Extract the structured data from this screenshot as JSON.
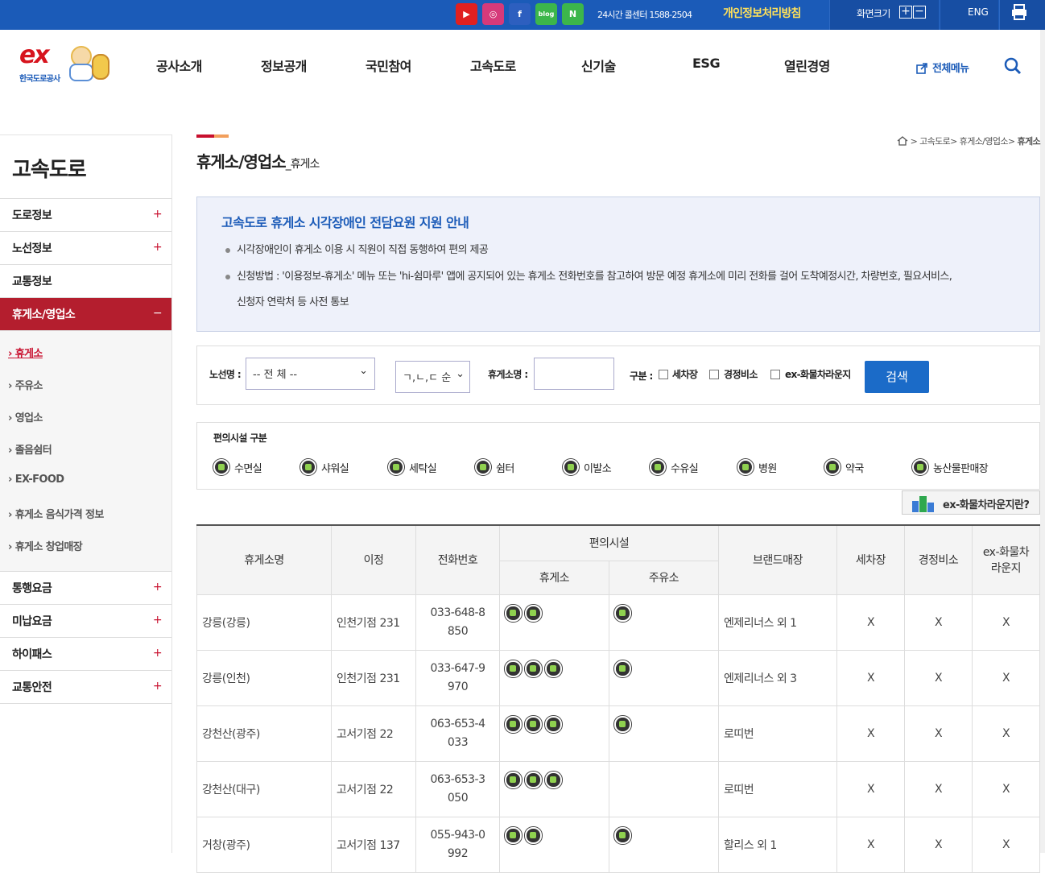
{
  "topbar": {
    "callcenter": "24시간 콜센터 1588-2504",
    "privacy": "개인정보처리방침",
    "font_size_label": "화면크기",
    "lang": "ENG",
    "sns": [
      "youtube-icon",
      "instagram-icon",
      "facebook-icon",
      "blog-icon",
      "naver-post-icon"
    ]
  },
  "logo": {
    "mark": "ex",
    "name": "한국도로공사"
  },
  "gnb": [
    "공사소개",
    "정보공개",
    "국민참여",
    "고속도로",
    "신기술",
    "ESG",
    "열린경영"
  ],
  "allmenu": "전체메뉴",
  "lnb": {
    "title": "고속도로",
    "items": [
      {
        "label": "도로정보",
        "sign": "+"
      },
      {
        "label": "노선정보",
        "sign": "+"
      },
      {
        "label": "교통정보",
        "sign": ""
      },
      {
        "label": "휴게소/영업소",
        "sign": "−"
      }
    ],
    "sub": [
      "휴게소",
      "주유소",
      "영업소",
      "졸음쉼터",
      "EX-FOOD",
      "휴게소 음식가격 정보",
      "휴게소 창업매장"
    ],
    "items2": [
      {
        "label": "통행요금",
        "sign": "+"
      },
      {
        "label": "미납요금",
        "sign": "+"
      },
      {
        "label": "하이패스",
        "sign": "+"
      },
      {
        "label": "교통안전",
        "sign": "+"
      }
    ]
  },
  "page": {
    "title": "휴게소/영업소",
    "subtitle": "_휴게소",
    "breadcrumb": "> 고속도로> 휴게소/영업소> ",
    "breadcrumb_current": "휴게소"
  },
  "notice": {
    "title": "고속도로 휴게소 시각장애인 전담요원 지원 안내",
    "line1": "시각장애인이 휴게소 이용 시 직원이 직접 동행하여 편의 제공",
    "line2": "신청방법 : '이용정보-휴게소' 메뉴 또는 'hi-쉼마루' 앱에 공지되어 있는 휴게소 전화번호를 참고하여 방문 예정 휴게소에 미리 전화를 걸어 도착예정시간, 차량번호, 필요서비스,",
    "line3": "신청자 연락처 등 사전 통보"
  },
  "search": {
    "route_label": "노선명 :",
    "route_value": "-- 전 체 --",
    "order_value": "ㄱ,ㄴ,ㄷ 순",
    "name_label": "휴게소명 :",
    "type_label": "구분 :",
    "opt1": "세차장",
    "opt2": "경정비소",
    "opt3": "ex-화물차라운지",
    "button": "검색"
  },
  "facilities": {
    "title": "편의시설 구분",
    "items": [
      "수면실",
      "샤워실",
      "세탁실",
      "쉼터",
      "이발소",
      "수유실",
      "병원",
      "약국",
      "농산물판매장"
    ]
  },
  "lounge_link": "ex-화물차라운지란?",
  "table": {
    "headers": {
      "name": "휴게소명",
      "dist": "이정",
      "phone": "전화번호",
      "facilities": "편의시설",
      "rest": "휴게소",
      "gas": "주유소",
      "brand": "브랜드매장",
      "wash": "세차장",
      "repair": "경정비소",
      "lounge": "ex-화물차라운지"
    },
    "rows": [
      {
        "name": "강릉(강릉)",
        "dist": "인천기점 231",
        "phone": "033-648-8850",
        "rest_icons": [
          "nursing-room-icon",
          "rest-area-icon"
        ],
        "gas_icons": [
          "rest-area-icon"
        ],
        "brand": "엔제리너스 외 1",
        "wash": "X",
        "repair": "X",
        "lounge": "X"
      },
      {
        "name": "강릉(인천)",
        "dist": "인천기점 231",
        "phone": "033-647-9970",
        "rest_icons": [
          "nursing-room-icon",
          "farm-market-icon",
          "rest-area-icon"
        ],
        "gas_icons": [
          "rest-area-icon"
        ],
        "brand": "엔제리너스 외 3",
        "wash": "X",
        "repair": "X",
        "lounge": "X"
      },
      {
        "name": "강천산(광주)",
        "dist": "고서기점 22",
        "phone": "063-653-4033",
        "rest_icons": [
          "nursing-room-icon",
          "farm-market-icon",
          "rest-area-icon"
        ],
        "gas_icons": [
          "rest-area-icon"
        ],
        "brand": "로띠번",
        "wash": "X",
        "repair": "X",
        "lounge": "X"
      },
      {
        "name": "강천산(대구)",
        "dist": "고서기점 22",
        "phone": "063-653-3050",
        "rest_icons": [
          "nursing-room-icon",
          "farm-market-icon",
          "rest-area-icon"
        ],
        "gas_icons": [],
        "brand": "로띠번",
        "wash": "X",
        "repair": "X",
        "lounge": "X"
      },
      {
        "name": "거창(광주)",
        "dist": "고서기점 137",
        "phone": "055-943-0992",
        "rest_icons": [
          "nursing-room-icon",
          "farm-market-icon"
        ],
        "gas_icons": [
          "rest-area-icon"
        ],
        "brand": "할리스 외 1",
        "wash": "X",
        "repair": "X",
        "lounge": "X"
      }
    ]
  }
}
